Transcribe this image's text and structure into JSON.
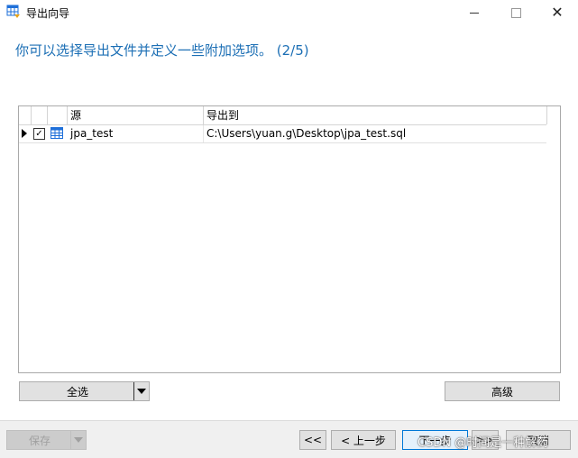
{
  "window": {
    "title": "导出向导",
    "icons": {
      "app": "table-export-icon",
      "minimize": "minimize-icon",
      "maximize": "maximize-icon",
      "close": "close-icon"
    },
    "close_glyph": "✕"
  },
  "instruction": "你可以选择导出文件并定义一些附加选项。 (2/5)",
  "grid": {
    "columns": [
      "源",
      "导出到"
    ],
    "rows": [
      {
        "checked": true,
        "check_glyph": "✓",
        "source": "jpa_test",
        "export_to": "C:\\Users\\yuan.g\\Desktop\\jpa_test.sql"
      }
    ]
  },
  "buttons": {
    "select_all": "全选",
    "advanced": "高级",
    "save": "保存",
    "first": "<<",
    "prev": "< 上一步",
    "next": "下一步",
    "last": ">>",
    "cancel": "取消"
  },
  "watermark": "CSDN @时间是一种解药",
  "colors": {
    "instruction": "#1c6fb5",
    "primary_border": "#0078d7",
    "table_icon": "#1e6fd9"
  }
}
